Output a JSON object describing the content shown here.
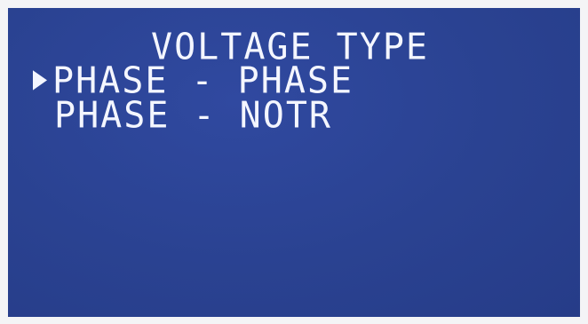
{
  "screen": {
    "title": "VOLTAGE TYPE",
    "options": [
      {
        "label": "PHASE - PHASE",
        "selected": true
      },
      {
        "label": "PHASE - NOTR",
        "selected": false
      }
    ],
    "cursor_icon": "right-triangle-icon",
    "colors": {
      "background": "#2b4393",
      "text": "#f4f6ff"
    }
  }
}
